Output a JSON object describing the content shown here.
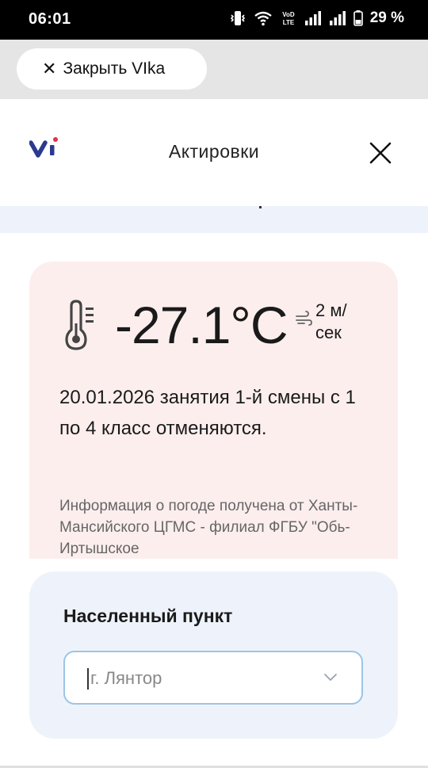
{
  "status_bar": {
    "time": "06:01",
    "battery": "29 %",
    "network_label_top": "VoD",
    "network_label_bottom": "LTE"
  },
  "close_bar": {
    "label": "Закрыть VIka"
  },
  "header": {
    "title": "Актировки"
  },
  "weather": {
    "temperature": "-27.1°C",
    "wind": "2 м/ сек",
    "notice": "20.01.2026 занятия 1-й смены с 1 по 4 класс отменяются.",
    "source": "Информация о погоде получена от Ханты-Мансийского ЦГМС - филиал ФГБУ \"Обь-Иртышское"
  },
  "location": {
    "label": "Населенный пункт",
    "value": "г. Лянтор"
  },
  "colors": {
    "brand": "#2b3a8f",
    "accent": "#e0344a",
    "weather_card_bg": "#fdeeee",
    "location_card_bg": "#eef3fb",
    "select_border": "#9cc4e6"
  }
}
